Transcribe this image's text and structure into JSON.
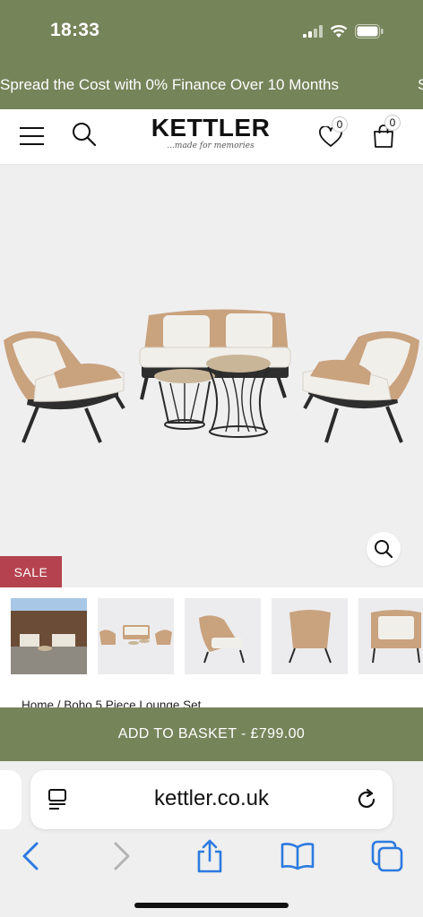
{
  "status_bar": {
    "time": "18:33"
  },
  "promo_banner": {
    "text": "Spread the Cost with 0% Finance Over 10 Months",
    "next_text": "S"
  },
  "header": {
    "logo": "KETTLER",
    "tagline": "...made for memories",
    "wishlist_count": "0",
    "basket_count": "0",
    "icons": [
      "menu-icon",
      "search-icon",
      "heart-icon",
      "shopping-bag-icon"
    ]
  },
  "product": {
    "sale_label": "SALE",
    "thumbnails": [
      "thumbnail-1",
      "thumbnail-2",
      "thumbnail-3",
      "thumbnail-4",
      "thumbnail-5"
    ],
    "breadcrumb": "Home / Boho 5 Piece Lounge Set",
    "add_to_basket": "ADD TO BASKET - £799.00"
  },
  "browser": {
    "url": "kettler.co.uk",
    "icons": [
      "reader-icon",
      "reload-icon",
      "back-icon",
      "forward-icon",
      "share-icon",
      "bookmarks-icon",
      "tabs-icon"
    ]
  },
  "colors": {
    "brand_green": "#76845a",
    "sale_red": "#b5424f",
    "ios_blue": "#2c7ae0"
  }
}
